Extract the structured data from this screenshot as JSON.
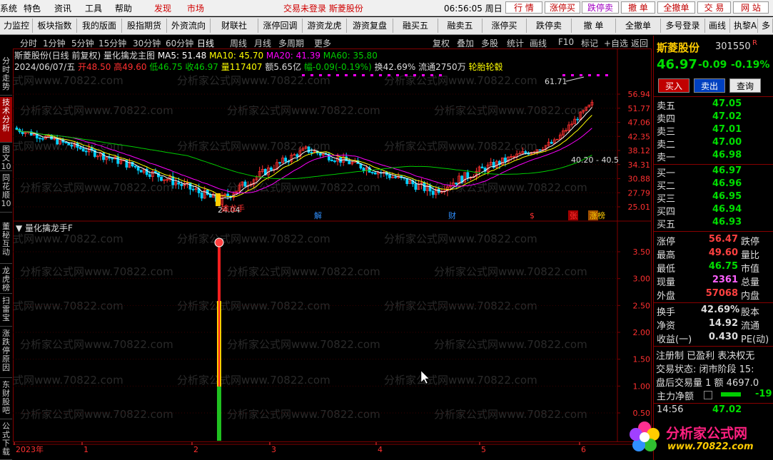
{
  "menubar": {
    "left_items": [
      "系统",
      "特色",
      "资讯",
      "工具",
      "帮助"
    ],
    "tab_items": [
      "发现",
      "市场"
    ],
    "status": "交易未登录  斯菱股份",
    "clock": "06:56:05 周日",
    "buttons": [
      "行 情",
      "涨停买",
      "跌停卖",
      "撤 单",
      "全撤单",
      "交 易",
      "网 站"
    ]
  },
  "toolbar2": [
    "力监控",
    "板块指数",
    "我的版面",
    "股指期货",
    "外资流向",
    "财联社",
    "涨停回调",
    "游资龙虎",
    "游资复盘",
    "融买五",
    "融卖五",
    "涨停买",
    "跌停卖",
    "撤 单",
    "全撤单",
    "多号登录",
    "画线",
    "执黎A",
    "多"
  ],
  "lefttabs": [
    "分时走势",
    "技术分析",
    "图文10",
    "同花顺10",
    "董秘互动",
    "龙虎榜",
    "扫雷宝",
    "涨跌停原因",
    "东财股吧",
    "公式下载"
  ],
  "periods": [
    "分时",
    "1分钟",
    "5分钟",
    "15分钟",
    "30分钟",
    "60分钟",
    "日线",
    "周线",
    "月线",
    "多周期",
    "更多"
  ],
  "period_active": "日线",
  "rightbtns": [
    "复权",
    "叠加",
    "多股",
    "统计",
    "画线",
    "F10",
    "标记",
    "+自选",
    "返回"
  ],
  "chartinfo": {
    "title": "斯菱股份(日线 前复权)",
    "indicator": "量化擒龙主图",
    "ma5": "MA5: 51.48",
    "ma10": "MA10: 45.70",
    "ma20": "MA20: 41.39",
    "ma60": "MA60: 35.80",
    "line2_date": "2024/06/07/五",
    "line2_open": "开48.50",
    "line2_high": "高49.60",
    "line2_low": "低46.75",
    "line2_close": "收46.97",
    "line2_vol": "量117407",
    "line2_amt": "额5.65亿",
    "line2_chg": "幅-0.09(-0.19%)",
    "line2_turn": "换42.69%",
    "line2_float": "流通2750万",
    "line2_concept": "轮胎轮毂",
    "high_label": "61.71",
    "low_label": "24.04",
    "low_tag": "擒龙手",
    "range_label": "40.20 - 40.5",
    "markers": [
      "解",
      "财",
      "$",
      "张",
      "涨榜"
    ],
    "subpanel_title": "量化擒龙手F",
    "x_labels": [
      "2023年",
      "1",
      "2",
      "3",
      "4",
      "5",
      "6"
    ]
  },
  "price_axis": [
    "56.94",
    "51.77",
    "47.06",
    "42.35",
    "38.12",
    "34.31",
    "30.88",
    "27.79",
    "25.01"
  ],
  "sub_axis": [
    "3.50",
    "3.00",
    "2.50",
    "2.00",
    "1.50",
    "1.00",
    "0.50"
  ],
  "watermark": "分析家公式网www.70822.com",
  "rightpanel": {
    "name": "斯菱股份",
    "code": "301550",
    "code_badge": "R",
    "price": "46.97",
    "change": "-0.09",
    "pct": "-0.19%",
    "buy_btn": "买入",
    "sell_btn": "卖出",
    "query_btn": "查询",
    "asks": [
      {
        "label": "卖五",
        "price": "47.05"
      },
      {
        "label": "卖四",
        "price": "47.02"
      },
      {
        "label": "卖三",
        "price": "47.01"
      },
      {
        "label": "卖二",
        "price": "47.00"
      },
      {
        "label": "卖一",
        "price": "46.98"
      }
    ],
    "bids": [
      {
        "label": "买一",
        "price": "46.97"
      },
      {
        "label": "买二",
        "price": "46.96"
      },
      {
        "label": "买三",
        "price": "46.95"
      },
      {
        "label": "买四",
        "price": "46.94"
      },
      {
        "label": "买五",
        "price": "46.93"
      }
    ],
    "stats": [
      {
        "l": "涨停",
        "v": "56.47",
        "r": "跌停",
        "vc": "#ff4040"
      },
      {
        "l": "最高",
        "v": "49.60",
        "r": "量比",
        "vc": "#ff4040"
      },
      {
        "l": "最低",
        "v": "46.75",
        "r": "市值",
        "vc": "#00dd00"
      },
      {
        "l": "现量",
        "v": "2361",
        "r": "总量",
        "vc": "#ff60ff"
      },
      {
        "l": "外盘",
        "v": "57068",
        "r": "内盘",
        "vc": "#ff4040"
      }
    ],
    "stats2": [
      {
        "l": "换手",
        "v": "42.69%",
        "r": "股本"
      },
      {
        "l": "净资",
        "v": "14.92",
        "r": "流通"
      },
      {
        "l": "收益(一)",
        "v": "0.430",
        "r": "PE(动)"
      }
    ],
    "reg": "注册制 已盈利 表决权无",
    "trade_state": "交易状态: 闭市阶段 15:",
    "after_trade": "盘后交易量 1 额 4697.0",
    "net_inflow": "主力净额",
    "net_inflow_val": "-19",
    "tick_time": "14:56",
    "tick_price": "47.02"
  },
  "logo": {
    "text": "分析家公式网",
    "url": "www.70822.com"
  },
  "colors": {
    "up": "#ff3030",
    "down": "#00d0ff",
    "ma5": "#ffffff",
    "ma10": "#ffff00",
    "ma20": "#ff00ff",
    "ma60": "#00cc00",
    "grid": "#800000"
  }
}
